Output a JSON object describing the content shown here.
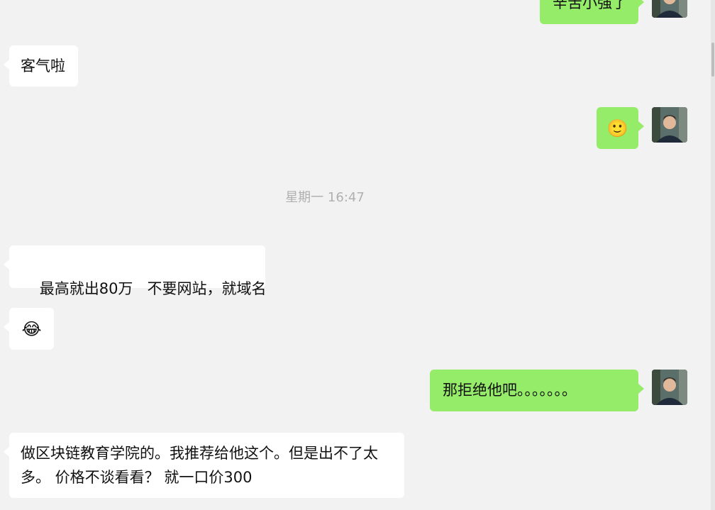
{
  "messages": [
    {
      "id": "m0",
      "side": "out",
      "text": "辛苦小强了"
    },
    {
      "id": "m1",
      "side": "in",
      "text": "客气啦"
    },
    {
      "id": "m2",
      "side": "out",
      "emoji": "smile-emoji",
      "text": "🙂"
    },
    {
      "id": "m3",
      "side": "in",
      "text": "最高就出80万   不要网站，就域名"
    },
    {
      "id": "m4",
      "side": "in",
      "emoji": "tears-of-joy-emoji",
      "text": "😂"
    },
    {
      "id": "m5",
      "side": "out",
      "text": "那拒绝他吧。。。。。。。"
    },
    {
      "id": "m6",
      "side": "in",
      "text": "做区块链教育学院的。我推荐给他这个。但是出不了太多。 价格不谈看看？ 就一口价300"
    }
  ],
  "timestamp": "星期一 16:47",
  "colors": {
    "background": "#f2f2f2",
    "incoming_bubble": "#ffffff",
    "outgoing_bubble": "#95ec69",
    "timestamp_text": "#b0b0b0"
  },
  "icons": {
    "avatar": "user-avatar-photo"
  }
}
